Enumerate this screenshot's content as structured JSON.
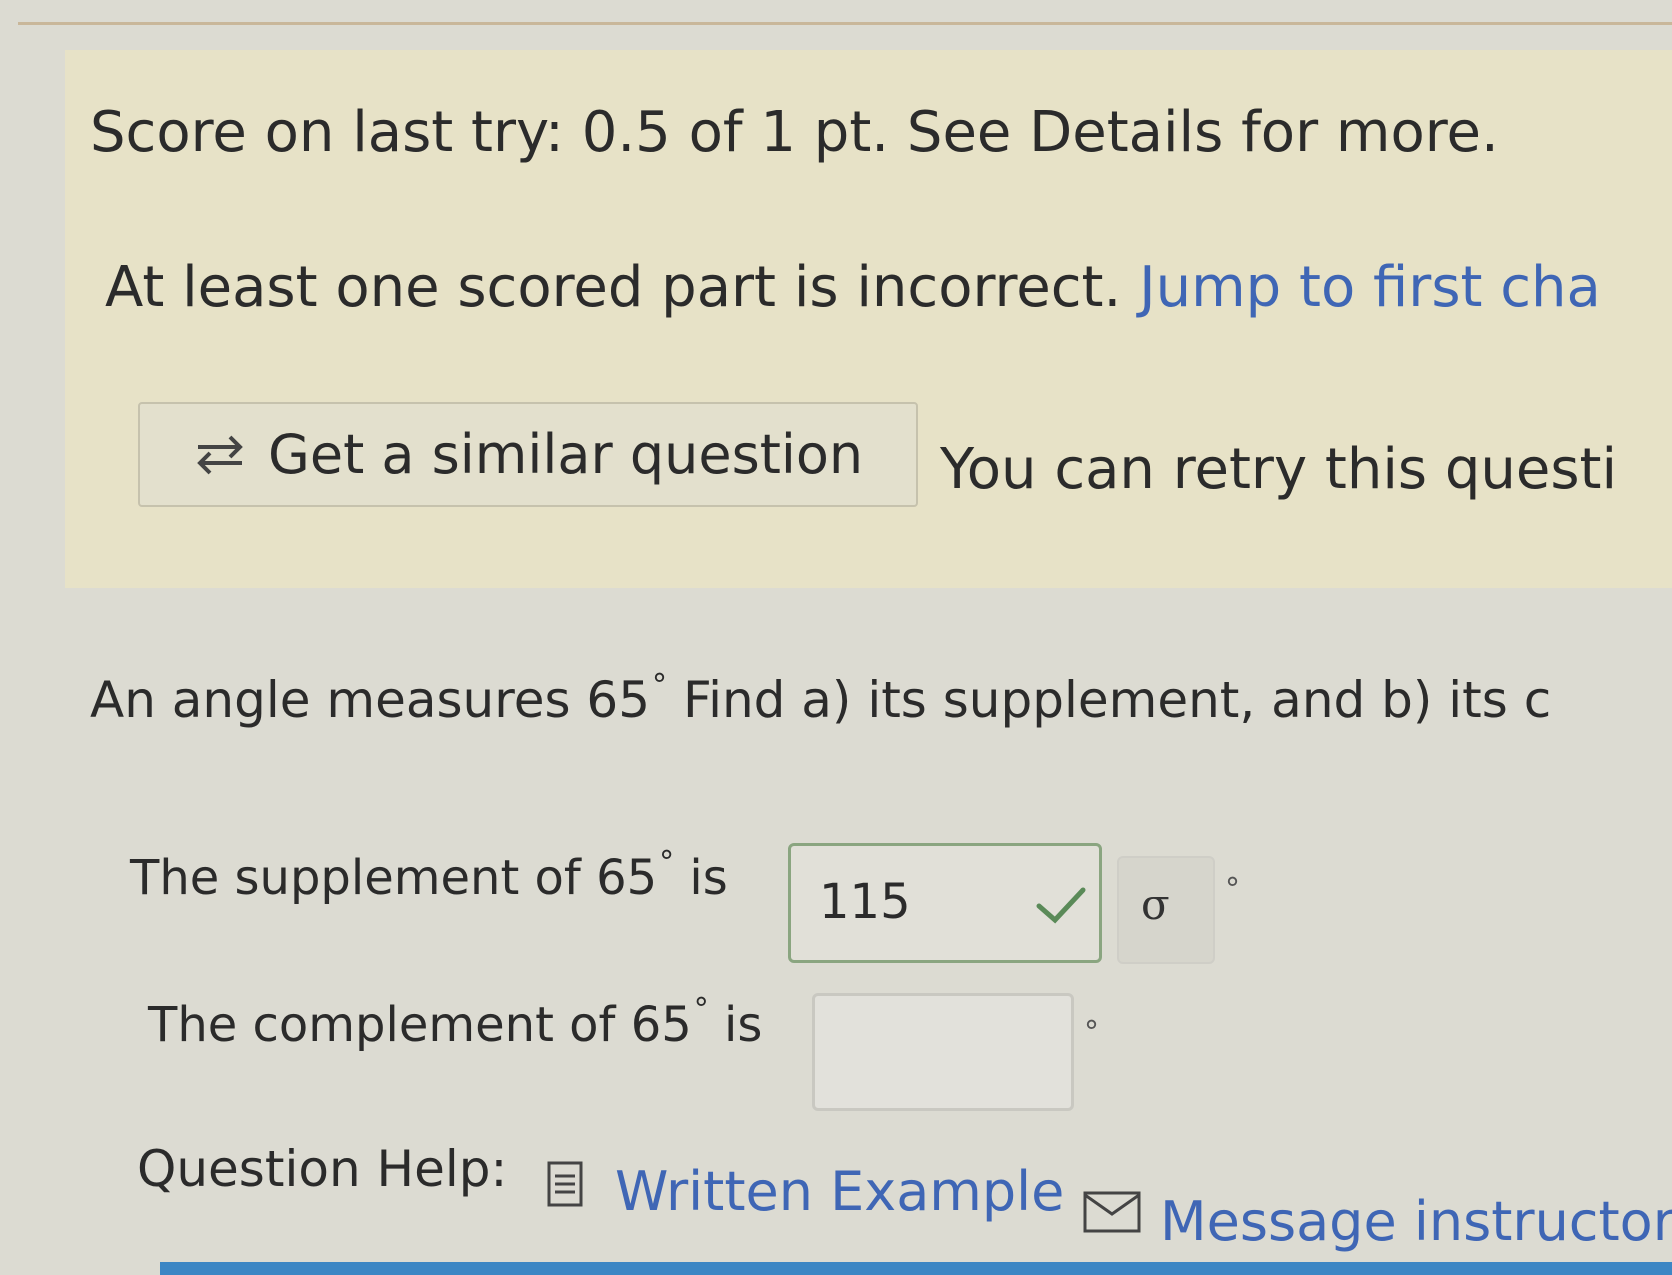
{
  "banner": {
    "score_text": "Score on last try: 0.5 of 1 pt. See Details for more.",
    "incorrect_text": "At least one scored part is incorrect.",
    "jump_link": "Jump to first cha",
    "similar_button": "Get a similar question",
    "retry_text": "You can retry this questi"
  },
  "question": {
    "prompt_before": "An angle measures ",
    "angle": "65",
    "degree": "°",
    "prompt_after": " Find a) its supplement, and b) its c"
  },
  "parts": [
    {
      "label_before": "The supplement of ",
      "angle": "65",
      "degree": "°",
      "label_after": " is",
      "value": "115",
      "status": "correct"
    },
    {
      "label_before": "The complement of ",
      "angle": "65",
      "degree": "°",
      "label_after": " is",
      "value": ""
    }
  ],
  "answer_unit": "°",
  "math_button": "σ",
  "help": {
    "label": "Question Help:",
    "written_example": "Written Example",
    "message_instructor": "Message instructor"
  },
  "colors": {
    "link": "#3f66b5",
    "correct_border": "#8aa580",
    "banner_bg": "#e7e2c7",
    "bottom_bar": "#3c86c4"
  },
  "icons": [
    "refresh-icon",
    "check-icon",
    "doc-icon",
    "mail-icon"
  ]
}
